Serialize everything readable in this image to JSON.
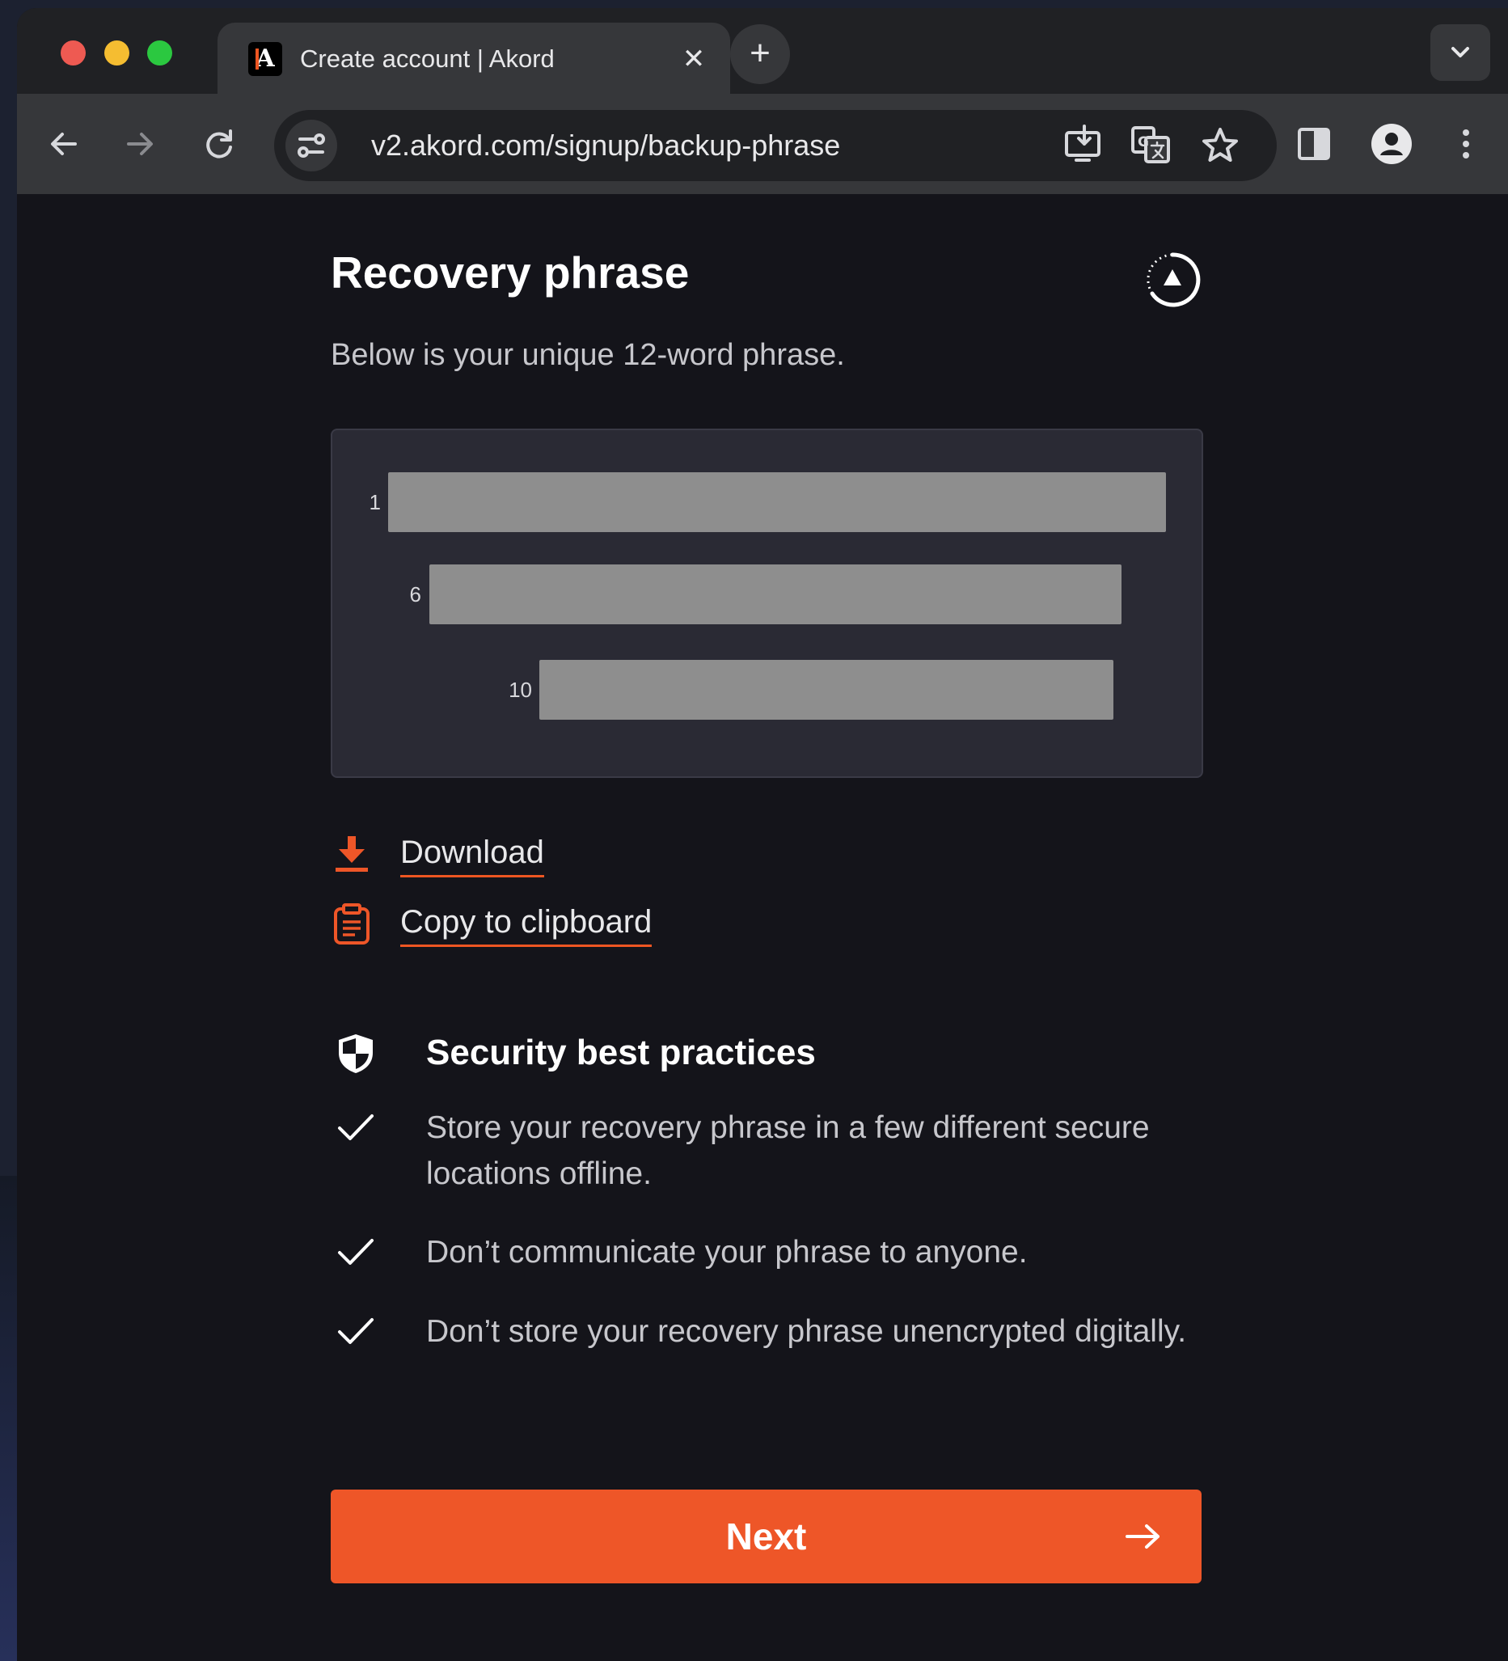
{
  "browser": {
    "tab": {
      "title": "Create account | Akord",
      "favicon_letter": "A",
      "close_glyph": "✕"
    },
    "new_tab_glyph": "+",
    "address_bar": {
      "url": "v2.akord.com/signup/backup-phrase"
    },
    "icons": [
      "back-icon",
      "forward-icon",
      "reload-icon",
      "site-info-icon",
      "install-app-icon",
      "translate-icon",
      "bookmark-star-icon",
      "side-panel-icon",
      "profile-icon",
      "more-menu-icon",
      "tab-list-chevron-icon"
    ]
  },
  "page": {
    "title": "Recovery phrase",
    "subtitle": "Below is your unique 12-word phrase.",
    "phrase_box": {
      "rows": [
        {
          "number": "1"
        },
        {
          "number": "6"
        },
        {
          "number": "10"
        }
      ]
    },
    "actions": {
      "download_label": "Download",
      "copy_label": "Copy to clipboard"
    },
    "security": {
      "title": "Security best practices",
      "practices": [
        "Store your recovery phrase in a few different secure locations offline.",
        "Don’t communicate your phrase to anyone.",
        "Don’t store your recovery phrase unencrypted digitally."
      ]
    },
    "next_button": {
      "label": "Next"
    }
  },
  "colors": {
    "accent": "#ee5628",
    "background": "#14141a",
    "phrase_box_bg": "#2a2a34",
    "mask": "#8e8e8e"
  }
}
